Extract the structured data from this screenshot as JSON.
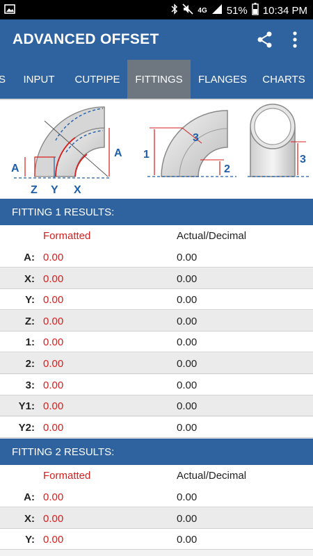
{
  "status_bar": {
    "network": "4G",
    "battery": "51%",
    "time": "10:34 PM"
  },
  "app_bar": {
    "title": "ADVANCED OFFSET"
  },
  "tabs": [
    {
      "label": "S"
    },
    {
      "label": "INPUT"
    },
    {
      "label": "CUTPIPE"
    },
    {
      "label": "FITTINGS",
      "active": true
    },
    {
      "label": "FLANGES"
    },
    {
      "label": "CHARTS"
    }
  ],
  "diagram": {
    "labels": [
      "A",
      "A",
      "Z",
      "Y",
      "X",
      "1",
      "2",
      "3",
      "3"
    ]
  },
  "fitting1": {
    "header": "FITTING 1 RESULTS:",
    "col_formatted": "Formatted",
    "col_actual": "Actual/Decimal",
    "rows": [
      {
        "label": "A:",
        "formatted": "0.00",
        "actual": "0.00"
      },
      {
        "label": "X:",
        "formatted": "0.00",
        "actual": "0.00"
      },
      {
        "label": "Y:",
        "formatted": "0.00",
        "actual": "0.00"
      },
      {
        "label": "Z:",
        "formatted": "0.00",
        "actual": "0.00"
      },
      {
        "label": "1:",
        "formatted": "0.00",
        "actual": "0.00"
      },
      {
        "label": "2:",
        "formatted": "0.00",
        "actual": "0.00"
      },
      {
        "label": "3:",
        "formatted": "0.00",
        "actual": "0.00"
      },
      {
        "label": "Y1:",
        "formatted": "0.00",
        "actual": "0.00"
      },
      {
        "label": "Y2:",
        "formatted": "0.00",
        "actual": "0.00"
      }
    ]
  },
  "fitting2": {
    "header": "FITTING 2 RESULTS:",
    "col_formatted": "Formatted",
    "col_actual": "Actual/Decimal",
    "rows": [
      {
        "label": "A:",
        "formatted": "0.00",
        "actual": "0.00"
      },
      {
        "label": "X:",
        "formatted": "0.00",
        "actual": "0.00"
      },
      {
        "label": "Y:",
        "formatted": "0.00",
        "actual": "0.00"
      }
    ]
  },
  "colors": {
    "primary": "#2f63a0",
    "active_tab": "#6e7680",
    "accent_red": "#d71d1d",
    "diagram_blue": "#1f5fa8"
  }
}
